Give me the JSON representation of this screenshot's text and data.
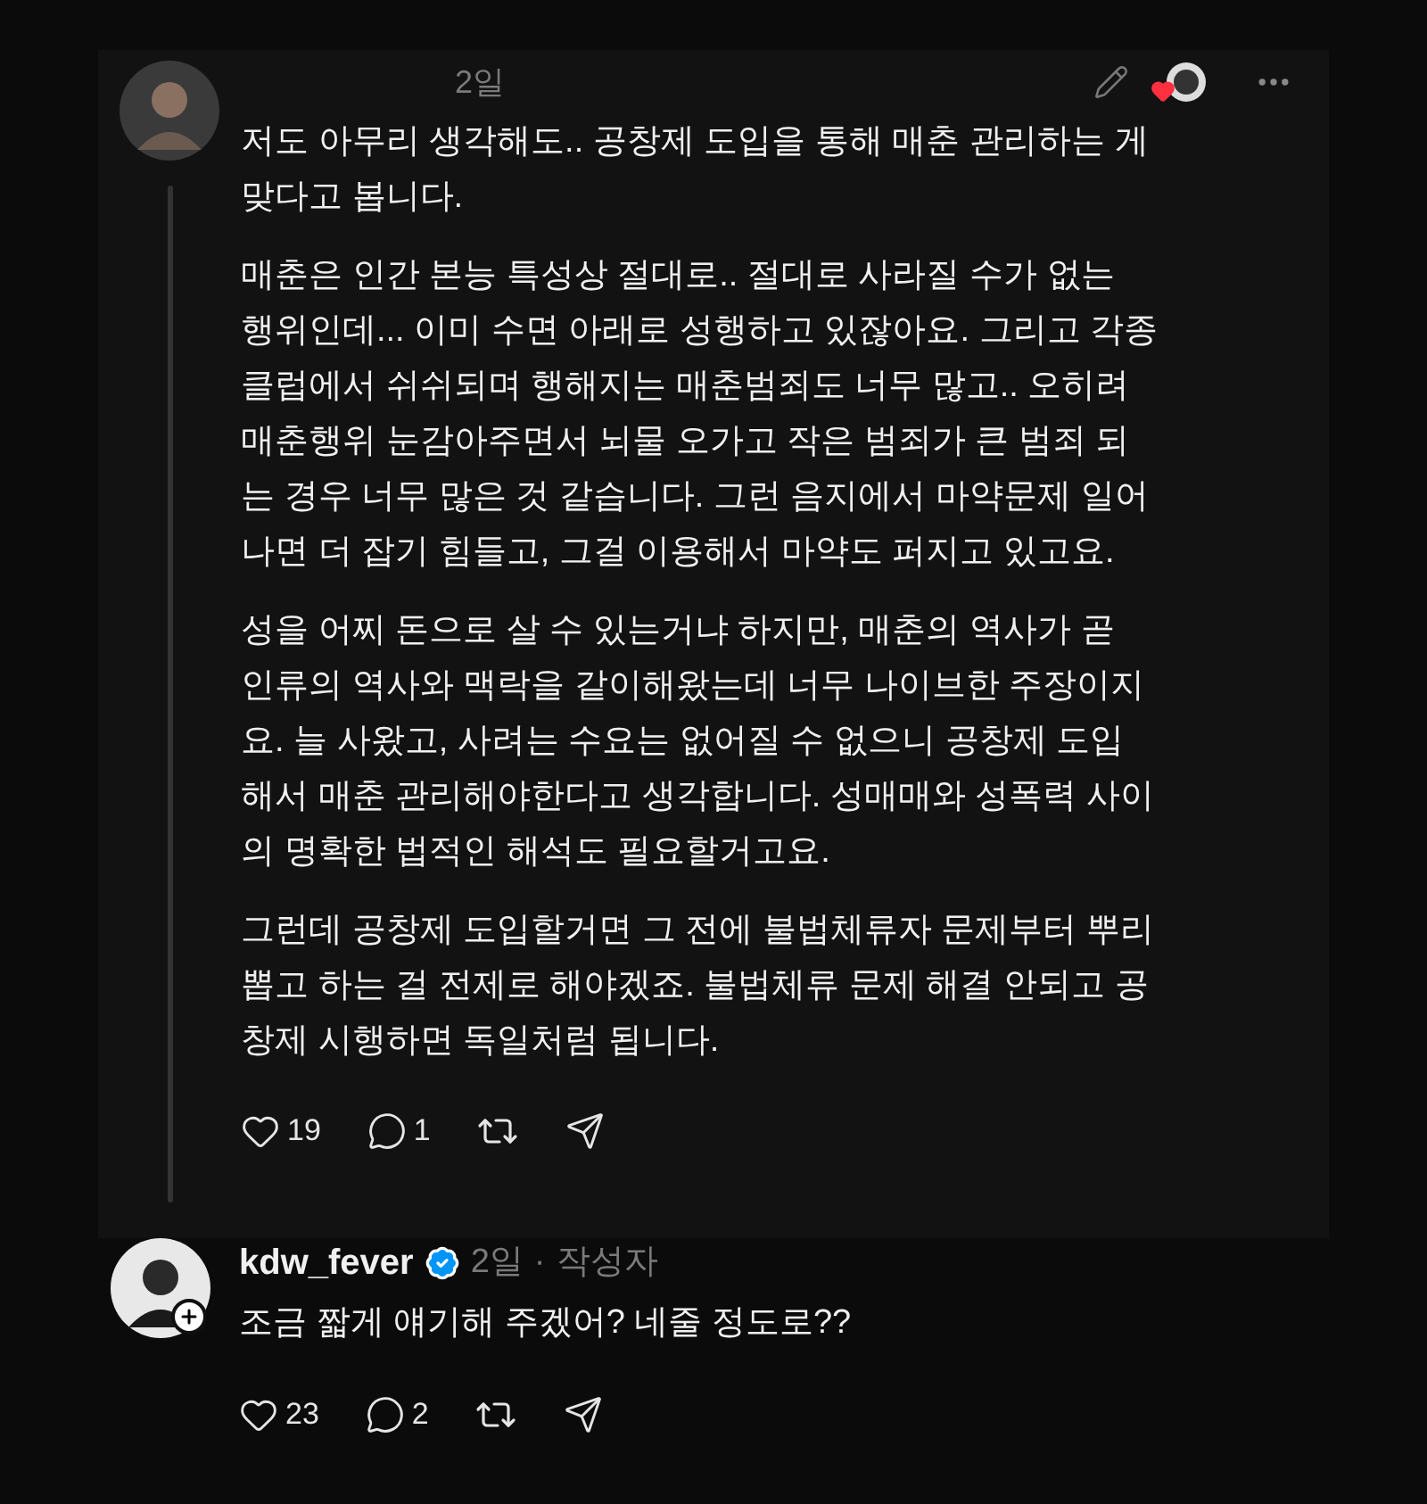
{
  "comment": {
    "time": "2일",
    "liked_by_author": true,
    "paragraphs": [
      [
        "저도 아무리 생각해도.. 공창제 도입을 통해 매춘 관리하는 게",
        "맞다고 봅니다."
      ],
      [
        "매춘은 인간 본능 특성상 절대로.. 절대로 사라질 수가 없는",
        "행위인데... 이미 수면 아래로 성행하고 있잖아요. 그리고 각종",
        "클럽에서 쉬쉬되며 행해지는 매춘범죄도 너무 많고.. 오히려",
        "매춘행위 눈감아주면서 뇌물 오가고 작은 범죄가 큰 범죄 되",
        "는 경우 너무 많은 것 같습니다. 그런 음지에서 마약문제 일어",
        "나면 더 잡기 힘들고, 그걸 이용해서 마약도 퍼지고 있고요."
      ],
      [
        "성을 어찌 돈으로 살 수 있는거냐 하지만, 매춘의 역사가 곧",
        "인류의 역사와 맥락을 같이해왔는데 너무 나이브한 주장이지",
        "요. 늘 사왔고, 사려는 수요는 없어질 수 없으니 공창제 도입",
        "해서 매춘 관리해야한다고 생각합니다. 성매매와 성폭력 사이",
        "의 명확한 법적인 해석도 필요할거고요."
      ],
      [
        "그런데 공창제 도입할거면 그 전에 불법체류자 문제부터 뿌리",
        "뽑고 하는 걸 전제로 해야겠죠. 불법체류 문제 해결 안되고 공",
        "창제 시행하면 독일처럼 됩니다."
      ]
    ],
    "likes": "19",
    "replies": "1"
  },
  "reply": {
    "username": "kdw_fever",
    "verified": true,
    "time": "2일",
    "separator": "·",
    "role": "작성자",
    "text": "조금 짧게 얘기해 주겠어? 네줄 정도로??",
    "likes": "23",
    "replies": "2"
  }
}
